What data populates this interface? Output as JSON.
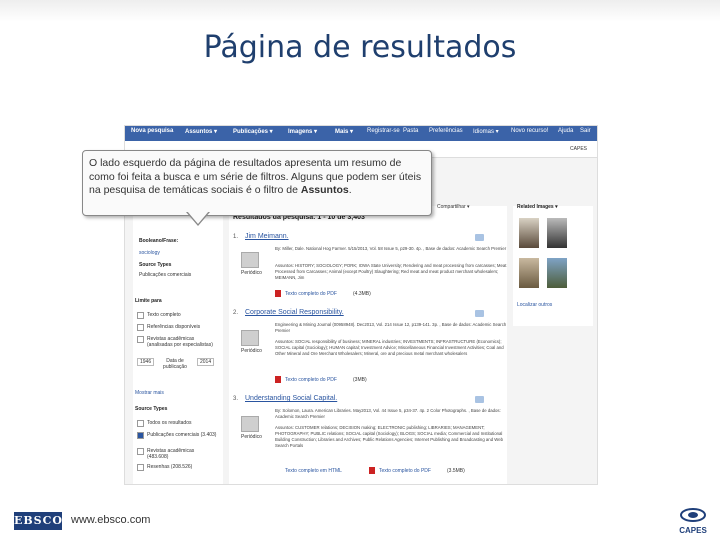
{
  "slide": {
    "title": "Página de resultados",
    "footer_logo": "EBSCO",
    "footer_url": "www.ebsco.com",
    "capes_logo": "CAPES"
  },
  "navbar": {
    "items": [
      "Nova pesquisa",
      "Assuntos ▾",
      "Publicações ▾",
      "Imagens ▾",
      "Mais ▾",
      "Registrar-se",
      "Pasta",
      "Preferências",
      "Idiomas ▾",
      "Novo recurso!",
      "Ajuda",
      "Sair"
    ]
  },
  "subbar": {
    "institution": "CAPES"
  },
  "callout": {
    "text_before": "O lado esquerdo da página de resultados apresenta um resumo de como foi feita a busca e um série de filtros. Alguns que podem ser úteis na pesquisa de temáticas sociais é o filtro de ",
    "text_bold": "Assuntos",
    "text_after": "."
  },
  "left_panel": {
    "query_label": "Booleano/Frase:",
    "query_value": "sociology",
    "source_types_label": "Source Types",
    "source_types_value": "Publicações comerciais",
    "limit_label": "Limite para",
    "limits": [
      "Texto completo",
      "Referências disponíveis",
      "Revistas acadêmicas (analisadas por especialistas)"
    ],
    "date_from": "1946",
    "date_label": "Data de publicação",
    "date_to": "2014",
    "show_more": "Mostrar mais",
    "source_types_heading": "Source Types",
    "types": [
      {
        "label": "Todos os resultados",
        "checked": false
      },
      {
        "label": "Publicações comerciais (3.403)",
        "checked": true
      },
      {
        "label": "Revistas acadêmicas (483.608)",
        "checked": false
      },
      {
        "label": "Resenhas (208.526)",
        "checked": false
      }
    ]
  },
  "results": {
    "header": "Resultados da pesquisa: 1 - 10 de 3,403",
    "sort": "Compartilhar ▾",
    "items": [
      {
        "num": "1.",
        "title": "Jim Meimann.",
        "meta": "By: Miller, Dale. National Hog Farmer. 5/15/2013, Vol. 58 Issue 5, p29-30. 4p. , Base de dados: Academic Search Premier",
        "subjects": "Assuntos: HISTORY; SOCIOLOGY; PORK; IOWA State University; Rendering and meat processing from carcasses; Meat Processed from Carcasses; Animal (except Poultry) Slaughtering; Red meat and meat product merchant wholesalers; MEIMANN, Jim",
        "type": "Periódico",
        "link": "Texto completo do PDF",
        "size": "(4.3MB)"
      },
      {
        "num": "2.",
        "title": "Corporate Social Responsibility.",
        "meta": "Engineering & Mining Journal (00958948). Dec2013, Vol. 214 Issue 12, p139-141. 3p. , Base de dados: Academic Search Premier",
        "subjects": "Assuntos: SOCIAL responsibility of business; MINERAL industries; INVESTMENTS; INFRASTRUCTURE (Economics); SOCIAL capital (Sociology); HUMAN capital; Investment Advice; Miscellaneous Financial Investment Activities; Coal and Other Mineral and Ore Merchant Wholesalers; Mineral, ore and precious metal merchant wholesalers",
        "type": "Periódico",
        "link": "Texto completo do PDF",
        "size": "(3MB)"
      },
      {
        "num": "3.",
        "title": "Understanding Social Capital.",
        "meta": "By: Solomon, Laura. American Libraries. May2013, Vol. 44 Issue 5, p34-37. 4p. 2 Color Photographs. , Base de dados: Academic Search Premier",
        "subjects": "Assuntos: CUSTOMER relations; DECISION making; ELECTRONIC publishing; LIBRARIES; MANAGEMENT; PHOTOGRAPHY; PUBLIC relations; SOCIAL capital (Sociology); BLOGS; SOCIAL media; Commercial and Institutional Building Construction; Libraries and Archives; Public Relations Agencies; Internet Publishing and Broadcasting and Web Search Portals",
        "type": "Periódico",
        "link_html": "Texto completo em HTML",
        "link": "Texto completo do PDF",
        "size": "(3.5MB)"
      }
    ]
  },
  "related": {
    "heading": "Related Images ▾",
    "footer": "Localizar outros"
  }
}
